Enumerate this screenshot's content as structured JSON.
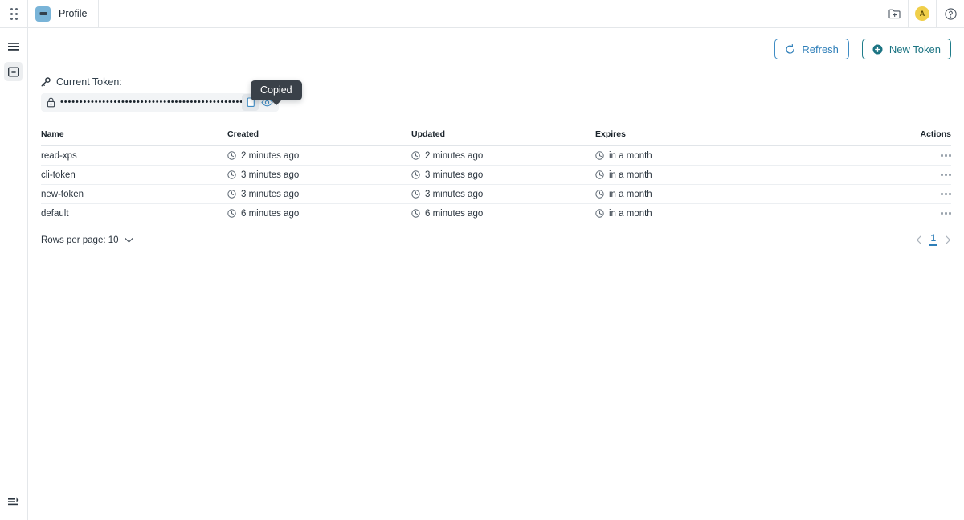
{
  "window": {
    "tab_title": "Profile",
    "logo_icon": "app-logo-icon",
    "grip_icon": "drag-grip-icon"
  },
  "topbar_right": {
    "new_folder_icon": "new-folder-icon",
    "avatar_initial": "A",
    "help_icon": "help-circle-icon"
  },
  "rail": {
    "menu_icon": "hamburger-menu-icon",
    "panel_icon": "panel-toggle-icon",
    "collapse_icon": "sidebar-collapse-icon"
  },
  "toolbar": {
    "refresh_label": "Refresh",
    "refresh_icon": "refresh-icon",
    "new_token_label": "New Token",
    "new_token_icon": "plus-circle-icon"
  },
  "token": {
    "label": "Current Token:",
    "key_icon": "key-icon",
    "lock_icon": "lock-icon",
    "masked_value": "••••••••••••••••••••••••••••••••••••••••••••••••••••",
    "copy_icon": "copy-icon",
    "reveal_icon": "eye-icon",
    "tooltip": "Copied"
  },
  "table": {
    "columns": [
      "Name",
      "Created",
      "Updated",
      "Expires",
      "Actions"
    ],
    "clock_icon": "clock-icon",
    "row_menu_icon": "more-horizontal-icon",
    "rows": [
      {
        "name": "read-xps",
        "created": "2 minutes ago",
        "updated": "2 minutes ago",
        "expires": "in a month"
      },
      {
        "name": "cli-token",
        "created": "3 minutes ago",
        "updated": "3 minutes ago",
        "expires": "in a month"
      },
      {
        "name": "new-token",
        "created": "3 minutes ago",
        "updated": "3 minutes ago",
        "expires": "in a month"
      },
      {
        "name": "default",
        "created": "6 minutes ago",
        "updated": "6 minutes ago",
        "expires": "in a month"
      }
    ]
  },
  "footer": {
    "rows_per_page_label": "Rows per page: 10",
    "chevron_icon": "chevron-down-icon",
    "prev_icon": "chevron-left-icon",
    "next_icon": "chevron-right-icon",
    "current_page": "1"
  },
  "colors": {
    "refresh_accent": "#2f7fb9",
    "new_token_accent": "#1c7483",
    "avatar_bg": "#f0cf4a",
    "tooltip_bg": "#3a4149",
    "logo_bg": "#79b4d8"
  }
}
